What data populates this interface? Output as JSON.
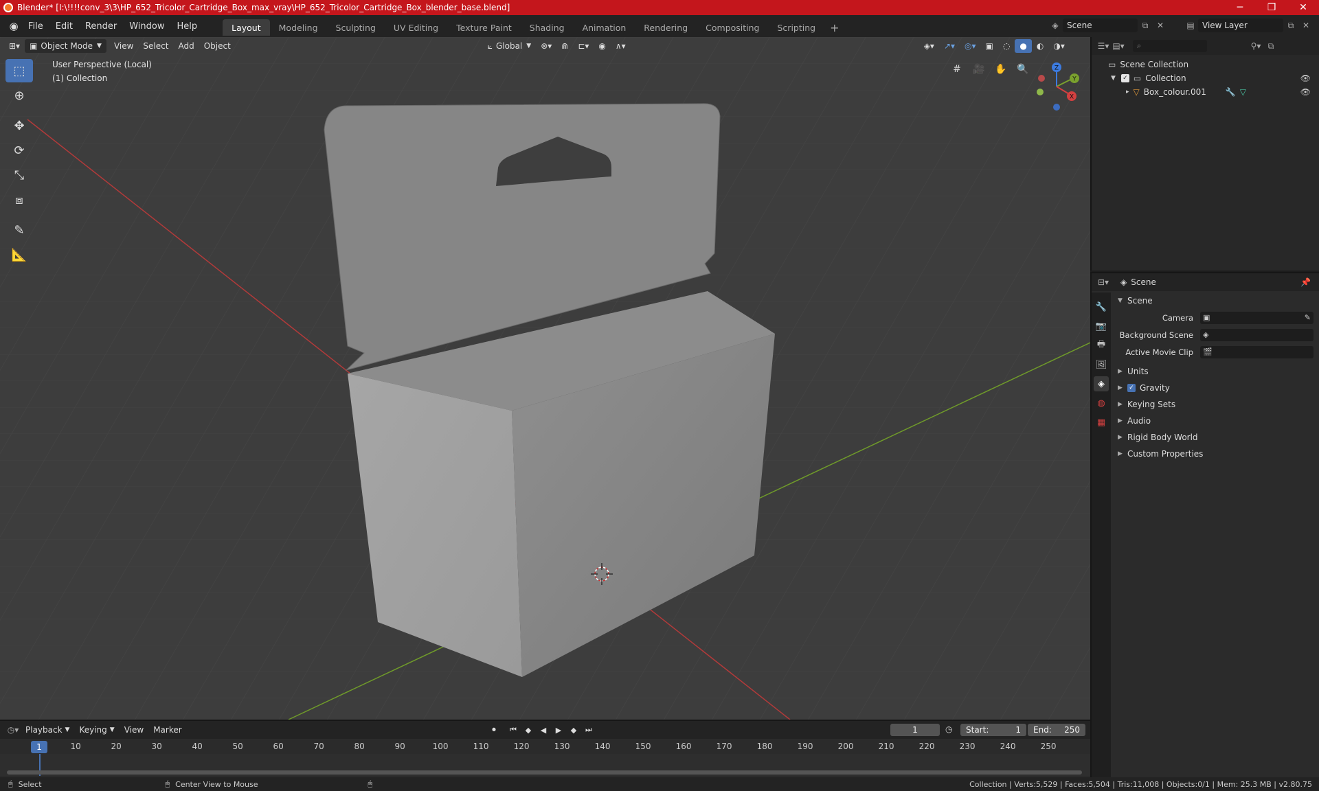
{
  "window": {
    "title": "Blender* [I:\\!!!!conv_3\\3\\HP_652_Tricolor_Cartridge_Box_max_vray\\HP_652_Tricolor_Cartridge_Box_blender_base.blend]",
    "minimize": "─",
    "maximize": "❐",
    "close": "✕"
  },
  "menu": {
    "items": [
      "File",
      "Edit",
      "Render",
      "Window",
      "Help"
    ]
  },
  "workspaces": {
    "tabs": [
      "Layout",
      "Modeling",
      "Sculpting",
      "UV Editing",
      "Texture Paint",
      "Shading",
      "Animation",
      "Rendering",
      "Compositing",
      "Scripting"
    ],
    "active": "Layout",
    "add": "+"
  },
  "scene_selector": {
    "value": "Scene"
  },
  "view_layer_selector": {
    "value": "View Layer"
  },
  "viewport": {
    "mode": "Object Mode",
    "menus": [
      "View",
      "Select",
      "Add",
      "Object"
    ],
    "orientation": "Global",
    "overlay_title": "User Perspective (Local)",
    "overlay_collection": "(1) Collection",
    "gizmo": {
      "z": "Z",
      "y": "Y",
      "x": "X"
    },
    "colors": {
      "background": "#3d3d3d",
      "x_axis": "#c23a3a",
      "y_axis": "#7aa12e",
      "active_tool": "#4772b3"
    }
  },
  "outliner": {
    "search_placeholder": "",
    "rows": [
      {
        "label": "Scene Collection"
      },
      {
        "label": "Collection"
      },
      {
        "label": "Box_colour.001"
      }
    ]
  },
  "properties": {
    "header": "Scene",
    "panel": "Scene",
    "fields": {
      "camera_label": "Camera",
      "background_scene_label": "Background Scene",
      "active_movie_clip_label": "Active Movie Clip"
    },
    "subpanels": [
      "Units",
      "Gravity",
      "Keying Sets",
      "Audio",
      "Rigid Body World",
      "Custom Properties"
    ],
    "gravity_checked": true
  },
  "timeline": {
    "menus": [
      "Playback",
      "Keying",
      "View",
      "Marker"
    ],
    "current_frame": "1",
    "start_label": "Start:",
    "start_value": "1",
    "end_label": "End:",
    "end_value": "250",
    "ticks": [
      "10",
      "20",
      "30",
      "40",
      "50",
      "60",
      "70",
      "80",
      "90",
      "100",
      "110",
      "120",
      "130",
      "140",
      "150",
      "160",
      "170",
      "180",
      "190",
      "200",
      "210",
      "220",
      "230",
      "240",
      "250"
    ],
    "cursor": "1"
  },
  "statusbar": {
    "select": "Select",
    "center_view": "Center View to Mouse",
    "stats": "Collection | Verts:5,529 | Faces:5,504 | Tris:11,008 | Objects:0/1 | Mem: 25.3 MB | v2.80.75"
  }
}
